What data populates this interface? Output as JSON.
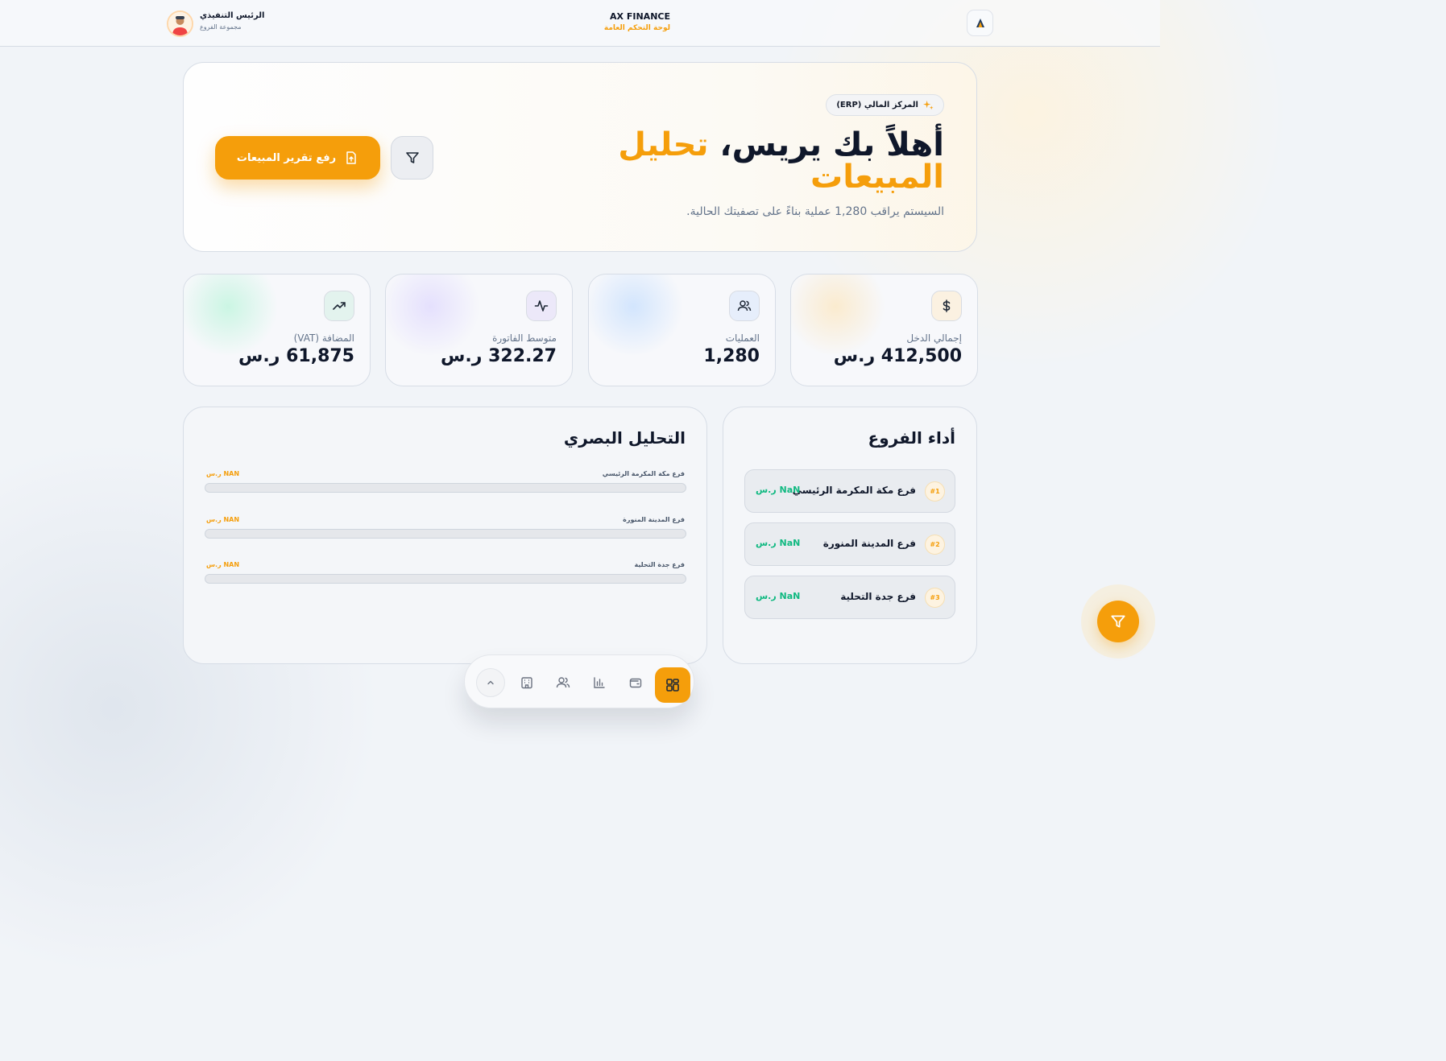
{
  "header": {
    "brand_title": "AX FINANCE",
    "brand_subtitle": "لوحة التحكم العامة",
    "user_name": "الرئيس التنفيذي",
    "user_role": "مجموعة الفروع"
  },
  "hero": {
    "badge": "المركز المالي (ERP)",
    "title_plain": "أهلاً بك يريس، ",
    "title_accent": "تحليل المبيعات",
    "subtitle": "السيستم يراقب 1,280 عملية بناءً على تصفيتك الحالية.",
    "upload_label": "رفع تقرير المبيعات"
  },
  "stats": [
    {
      "label": "إجمالي الدخل",
      "value": "412,500 ر.س",
      "icon": "dollar-icon",
      "color": "#f59e0b"
    },
    {
      "label": "العمليات",
      "value": "1,280",
      "icon": "users-icon",
      "color": "#3b82f6"
    },
    {
      "label": "متوسط الفاتورة",
      "value": "322.27 ر.س",
      "icon": "activity-icon",
      "color": "#8b5cf6"
    },
    {
      "label": "المضافة (VAT)",
      "value": "61,875 ر.س",
      "icon": "trending-up-icon",
      "color": "#10b981"
    }
  ],
  "branches": {
    "title": "أداء الفروع",
    "items": [
      {
        "rank": "#1",
        "name": "فرع مكة المكرمة الرئيسي",
        "value": "NaN ر.س"
      },
      {
        "rank": "#2",
        "name": "فرع المدينة المنورة",
        "value": "NaN ر.س"
      },
      {
        "rank": "#3",
        "name": "فرع جدة التحلية",
        "value": "NaN ر.س"
      }
    ]
  },
  "visual": {
    "title": "التحليل البصري",
    "rows": [
      {
        "name": "فرع مكة المكرمة الرئيسي",
        "value": "NAN ر.س",
        "fill": 0
      },
      {
        "name": "فرع المدينة المنورة",
        "value": "NAN ر.س",
        "fill": 0
      },
      {
        "name": "فرع جدة التحلية",
        "value": "NAN ر.س",
        "fill": 0
      }
    ]
  },
  "dock": {
    "items": [
      "chevron-up-icon",
      "building-icon",
      "users-icon",
      "bar-chart-icon",
      "wallet-icon",
      "grid-icon"
    ],
    "active": "grid-icon"
  },
  "colors": {
    "accent": "#f59e0b",
    "success": "#10b981",
    "text": "#0f172a",
    "muted": "#64748b"
  }
}
